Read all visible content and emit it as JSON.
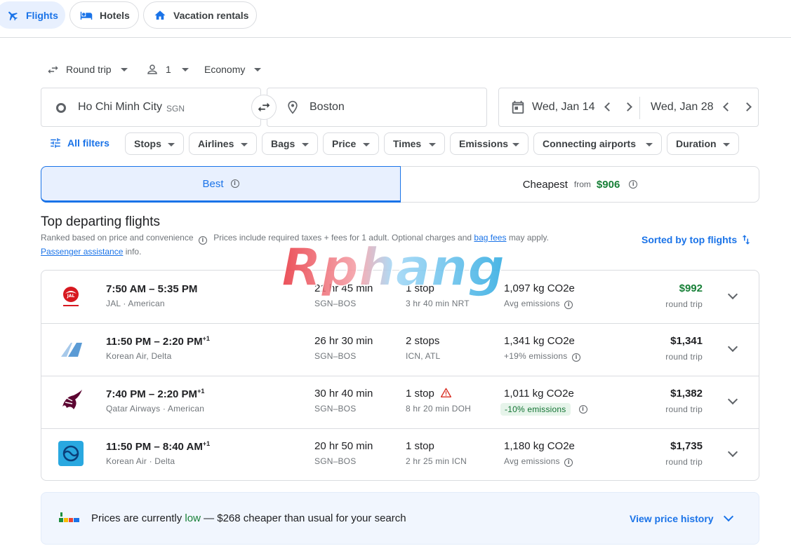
{
  "nav": {
    "tabs": [
      {
        "label": "Flights",
        "icon": "plane-icon",
        "active": true
      },
      {
        "label": "Hotels",
        "icon": "bed-icon",
        "active": false
      },
      {
        "label": "Vacation rentals",
        "icon": "house-icon",
        "active": false
      }
    ]
  },
  "search": {
    "trip_type": "Round trip",
    "passengers": "1",
    "cabin": "Economy",
    "origin": "Ho Chi Minh City",
    "origin_code": "SGN",
    "destination": "Boston",
    "depart_date": "Wed, Jan 14",
    "return_date": "Wed, Jan 28"
  },
  "filters": {
    "all_filters_label": "All filters",
    "chips": [
      "Stops",
      "Airlines",
      "Bags",
      "Price",
      "Times",
      "Emissions",
      "Connecting airports",
      "Duration"
    ]
  },
  "sort_tabs": {
    "best_label": "Best",
    "cheapest_label": "Cheapest",
    "cheapest_from": "from",
    "cheapest_price": "$906"
  },
  "results": {
    "heading": "Top departing flights",
    "ranked_note": "Ranked based on price and convenience",
    "prices_note_pre": "Prices include required taxes + fees for 1 adult. Optional charges and",
    "bag_fees_link": "bag fees",
    "prices_note_post": "may apply.",
    "assistance_link": "Passenger assistance",
    "assistance_post": "info.",
    "sorted_label": "Sorted by top flights"
  },
  "flights": [
    {
      "airline_logo": "jal-crane-logo",
      "times": "7:50 AM – 5:35 PM",
      "plus_day": "",
      "airlines": "JAL · American",
      "duration": "21 hr 45 min",
      "route": "SGN–BOS",
      "stops": "1 stop",
      "layover": "3 hr 40 min NRT",
      "warning": false,
      "co2": "1,097 kg CO2e",
      "emissions": "Avg emissions",
      "emissions_badge": false,
      "price": "$992",
      "price_green": true,
      "price_type": "round trip"
    },
    {
      "airline_logo": "korean-delta-tail-logo",
      "times": "11:50 PM – 2:20 PM",
      "plus_day": "+1",
      "airlines": "Korean Air, Delta",
      "duration": "26 hr 30 min",
      "route": "SGN–BOS",
      "stops": "2 stops",
      "layover": "ICN, ATL",
      "warning": false,
      "co2": "1,341 kg CO2e",
      "emissions": "+19% emissions",
      "emissions_badge": false,
      "price": "$1,341",
      "price_green": false,
      "price_type": "round trip"
    },
    {
      "airline_logo": "qatar-oryx-logo",
      "times": "7:40 PM – 2:20 PM",
      "plus_day": "+1",
      "airlines": "Qatar Airways · American",
      "duration": "30 hr 40 min",
      "route": "SGN–BOS",
      "stops": "1 stop",
      "layover": "8 hr 20 min DOH",
      "warning": true,
      "co2": "1,011 kg CO2e",
      "emissions": "-10% emissions",
      "emissions_badge": true,
      "price": "$1,382",
      "price_green": false,
      "price_type": "round trip"
    },
    {
      "airline_logo": "korean-air-taegeuk-logo",
      "times": "11:50 PM – 8:40 AM",
      "plus_day": "+1",
      "airlines": "Korean Air · Delta",
      "duration": "20 hr 50 min",
      "route": "SGN–BOS",
      "stops": "1 stop",
      "layover": "2 hr 25 min ICN",
      "warning": false,
      "co2": "1,180 kg CO2e",
      "emissions": "Avg emissions",
      "emissions_badge": false,
      "price": "$1,735",
      "price_green": false,
      "price_type": "round trip"
    }
  ],
  "price_insight": {
    "pre": "Prices are currently",
    "level": "low",
    "post": "— $268 cheaper than usual for your search",
    "link": "View price history"
  },
  "watermark": {
    "text": "Rphang"
  },
  "colors": {
    "accent": "#1a73e8",
    "green_price": "#188038",
    "border": "#dadce0",
    "best_tab_bg": "#e8f0fe"
  }
}
